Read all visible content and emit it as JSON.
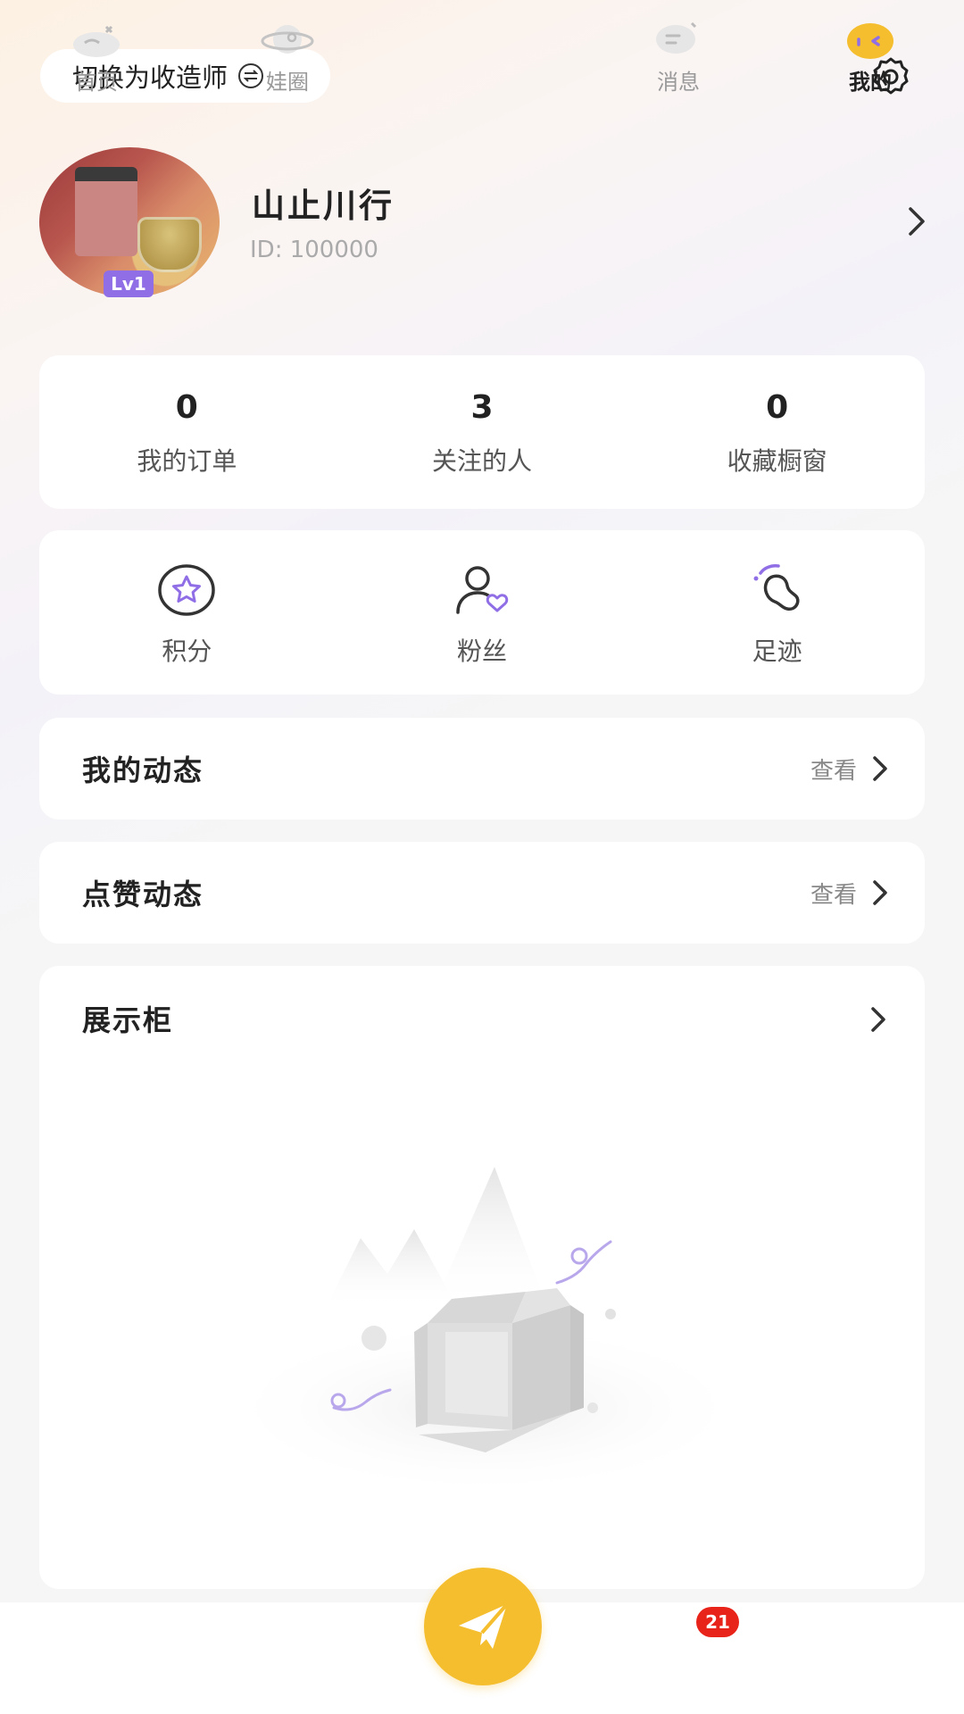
{
  "header": {
    "switch_label": "切换为收造师",
    "switch_icon": "swap-icon",
    "settings_icon": "gear-icon"
  },
  "profile": {
    "name": "山止川行",
    "id_text": "ID: 100000",
    "level": "Lv1"
  },
  "stats": [
    {
      "value": "0",
      "label": "我的订单"
    },
    {
      "value": "3",
      "label": "关注的人"
    },
    {
      "value": "0",
      "label": "收藏橱窗"
    }
  ],
  "quick_links": [
    {
      "label": "积分",
      "icon": "star-icon"
    },
    {
      "label": "粉丝",
      "icon": "fans-icon"
    },
    {
      "label": "足迹",
      "icon": "footprint-icon"
    }
  ],
  "rows": {
    "moments": {
      "title": "我的动态",
      "action": "查看"
    },
    "likes": {
      "title": "点赞动态",
      "action": "查看"
    },
    "showcase": {
      "title": "展示柜"
    }
  },
  "tabbar": {
    "home": "首页",
    "circle": "娃圈",
    "messages": "消息",
    "me": "我的",
    "message_badge": "21",
    "publish_icon": "paper-plane-icon"
  },
  "colors": {
    "accent_purple": "#8f6ee6",
    "publish_yellow": "#f5be2e",
    "badge_red": "#e8231a"
  }
}
